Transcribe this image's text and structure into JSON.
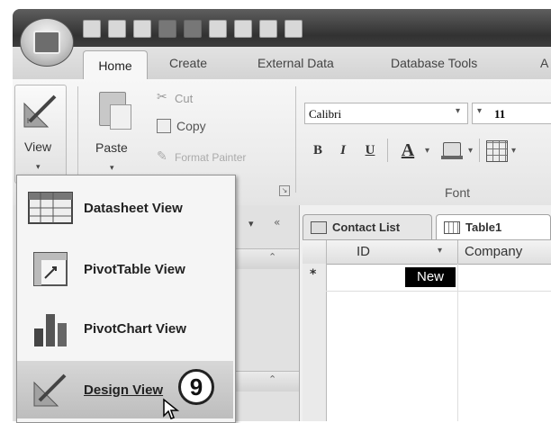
{
  "ribbon_tabs": [
    "Home",
    "Create",
    "External Data",
    "Database Tools",
    "A"
  ],
  "view_group": {
    "view_label": "View"
  },
  "clipboard": {
    "paste_label": "Paste",
    "cut_label": "Cut",
    "copy_label": "Copy",
    "format_painter_label": "Format Painter"
  },
  "font_group": {
    "font_name": "Calibri",
    "font_size": "11",
    "group_label": "Font",
    "bold": "B",
    "italic": "I",
    "underline": "U",
    "font_color": "A"
  },
  "view_menu": {
    "items": [
      {
        "label": "Datasheet View",
        "icon": "datasheet-icon"
      },
      {
        "label": "PivotTable View",
        "icon": "pivottable-icon"
      },
      {
        "label": "PivotChart View",
        "icon": "pivotchart-icon"
      },
      {
        "label": "Design View",
        "icon": "design-view-icon",
        "highlighted": true
      }
    ]
  },
  "doc_tabs": [
    "Contact List",
    "Table1"
  ],
  "table": {
    "columns": [
      "ID",
      "Company"
    ],
    "new_row": "New",
    "new_row_marker": "*"
  },
  "callout": {
    "number": "9"
  }
}
